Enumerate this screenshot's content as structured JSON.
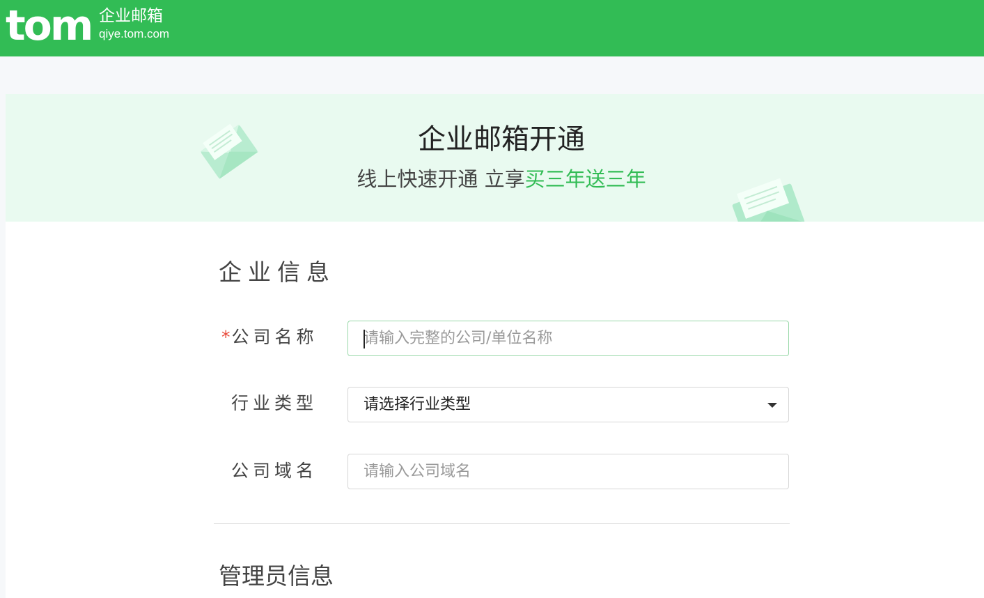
{
  "header": {
    "logo_text": "tom",
    "logo_product": "企业邮箱",
    "logo_domain": "qiye.tom.com",
    "bg_color": "#32bc55"
  },
  "banner": {
    "title": "企业邮箱开通",
    "subtitle_plain": "线上快速开通 立享",
    "subtitle_highlight": "买三年送三年",
    "highlight_color": "#32bc55"
  },
  "company_section": {
    "title": "企业信息",
    "fields": [
      {
        "label": "公司名称",
        "required_mark": "*",
        "placeholder": "请输入完整的公司/单位名称",
        "value": ""
      },
      {
        "label": "行业类型",
        "selected": "请选择行业类型",
        "icon": "chevron-down-icon"
      },
      {
        "label": "公司域名",
        "placeholder": "请输入公司域名",
        "value": ""
      }
    ]
  },
  "admin_section": {
    "title": "管理员信息"
  }
}
